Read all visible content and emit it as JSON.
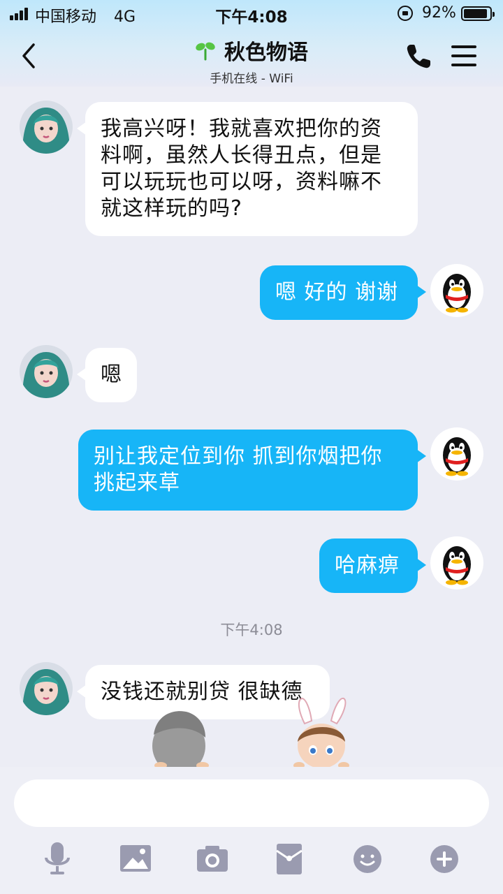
{
  "status_bar": {
    "carrier": "中国移动",
    "network": "4G",
    "time": "下午4:08",
    "battery_percent_text": "92%",
    "battery_level": 0.92
  },
  "header": {
    "title": "秋色物语",
    "subtitle": "手机在线 - WiFi"
  },
  "messages": [
    {
      "side": "in",
      "text": "我高兴呀！我就喜欢把你的资料啊，虽然人长得丑点，但是可以玩玩也可以呀，资料嘛不就这样玩的吗?"
    },
    {
      "side": "out",
      "text": "嗯 好的 谢谢"
    },
    {
      "side": "in",
      "text": "嗯"
    },
    {
      "side": "out",
      "text": "别让我定位到你 抓到你烟把你挑起来草"
    },
    {
      "side": "out",
      "text": "哈麻痹"
    },
    {
      "side": "in",
      "text": "没钱还就别贷 很缺德"
    }
  ],
  "timestamp": "下午4:08",
  "input": {
    "placeholder": ""
  },
  "toolbar": [
    "mic-icon",
    "image-icon",
    "camera-icon",
    "red-packet-icon",
    "emoji-icon",
    "plus-icon"
  ],
  "colors": {
    "out_bubble": "#17b5f7",
    "in_bubble": "#ffffff",
    "background": "#ecedf5"
  }
}
